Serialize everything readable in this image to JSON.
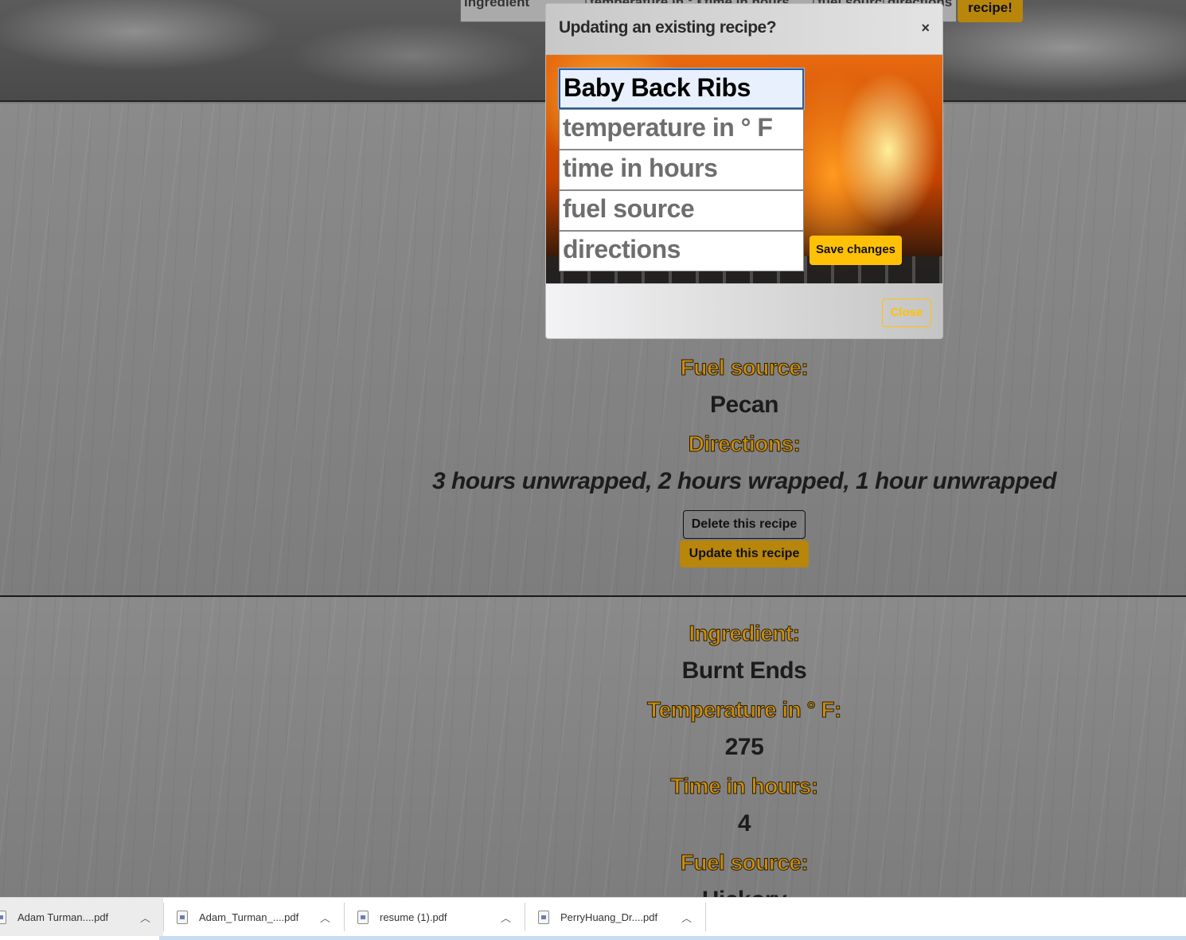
{
  "top_form": {
    "fields": [
      "ingredient",
      "temperature in ° F",
      "time in hours",
      "fuel source",
      "directions"
    ],
    "submit_label": "recipe!"
  },
  "modal": {
    "title": "Updating an existing recipe?",
    "close_x": "×",
    "fields": {
      "ingredient": "Baby Back Ribs",
      "temperature_placeholder": "temperature in ° F",
      "time_placeholder": "time in hours",
      "fuel_placeholder": "fuel source",
      "directions_placeholder": "directions"
    },
    "save_label": "Save changes",
    "close_label": "Close"
  },
  "recipe1": {
    "fuel_label": "Fuel source:",
    "fuel_value": "Pecan",
    "directions_label": "Directions:",
    "directions_value": "3 hours unwrapped, 2 hours wrapped, 1 hour unwrapped",
    "delete_label": "Delete this recipe",
    "update_label": "Update this recipe"
  },
  "recipe2": {
    "ingredient_label": "Ingredient:",
    "ingredient_value": "Burnt Ends",
    "temp_label": "Temperature in ° F:",
    "temp_value": "275",
    "time_label": "Time in hours:",
    "time_value": "4",
    "fuel_label": "Fuel source:",
    "fuel_value": "Hickory"
  },
  "downloads": [
    {
      "name": "Adam Turman....pdf"
    },
    {
      "name": "Adam_Turman_....pdf"
    },
    {
      "name": "resume (1).pdf"
    },
    {
      "name": "PerryHuang_Dr....pdf"
    }
  ],
  "colors": {
    "label_gold": "#c98e12",
    "accent_yellow": "#ffc107",
    "button_dark_gold": "#b8860b"
  }
}
